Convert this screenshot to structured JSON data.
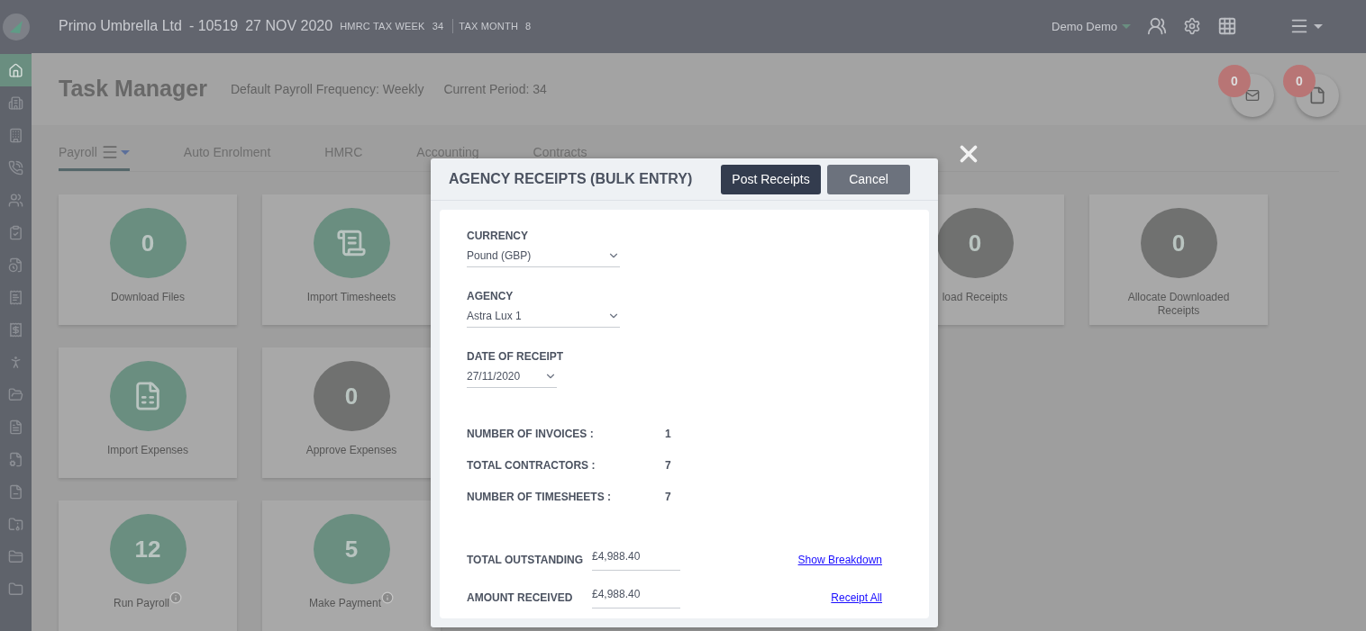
{
  "header": {
    "company": "Primo Umbrella Ltd",
    "company_code": "- 10519",
    "date": "27 NOV 2020",
    "tax_week_label": "HMRC TAX WEEK",
    "tax_week": "34",
    "tax_month_label": "TAX MONTH",
    "tax_month": "8",
    "user": "Demo Demo"
  },
  "sidebar": {
    "items": [
      {
        "selected": true
      },
      {
        "selected": false
      },
      {
        "selected": false
      },
      {
        "selected": false
      },
      {
        "selected": false
      },
      {
        "selected": false
      },
      {
        "selected": false
      },
      {
        "selected": false
      },
      {
        "selected": false
      },
      {
        "selected": false
      },
      {
        "selected": false
      },
      {
        "selected": false
      },
      {
        "selected": false
      },
      {
        "selected": false
      },
      {
        "selected": false
      },
      {
        "selected": false
      },
      {
        "selected": false
      }
    ]
  },
  "page": {
    "title": "Task Manager",
    "frequency": "Default Payroll Frequency: Weekly",
    "period": "Current Period: 34",
    "message_count": "0",
    "document_count": "0"
  },
  "tabs": [
    {
      "label": "Payroll",
      "selected": true
    },
    {
      "label": "Auto Enrolment",
      "selected": false
    },
    {
      "label": "HMRC",
      "selected": false
    },
    {
      "label": "Accounting",
      "selected": false
    },
    {
      "label": "Contracts",
      "selected": false
    }
  ],
  "tile_rows": [
    {
      "left": [
        {
          "kind": "count",
          "value": "0",
          "label": "Download Files",
          "color": "#6a8e80",
          "info": false
        },
        {
          "kind": "timesheet",
          "label": "Import Timesheets",
          "color": "#6a8e80",
          "info": false
        }
      ],
      "right": [
        {
          "kind": "count",
          "value": "0",
          "label": "load Receipts",
          "color": "#707170",
          "info": false
        },
        {
          "kind": "count",
          "value": "0",
          "label": "Allocate Downloaded Receipts",
          "color": "#707170",
          "info": false
        }
      ]
    },
    {
      "left": [
        {
          "kind": "expense",
          "label": "Import Expenses",
          "color": "#6a8e80",
          "info": false
        },
        {
          "kind": "count",
          "value": "0",
          "label": "Approve Expenses",
          "color": "#707170",
          "info": false
        }
      ],
      "right": []
    },
    {
      "left": [
        {
          "kind": "count",
          "value": "12",
          "label": "Run Payroll",
          "color": "#6a8e80",
          "info": true
        },
        {
          "kind": "count",
          "value": "5",
          "label": "Make Payment",
          "color": "#6a8e80",
          "info": true
        }
      ],
      "right": []
    }
  ],
  "modal": {
    "title": "AGENCY RECEIPTS (BULK ENTRY)",
    "post_button": "Post Receipts",
    "cancel_button": "Cancel",
    "currency": {
      "label": "CURRENCY",
      "value": "Pound (GBP)"
    },
    "agency": {
      "label": "AGENCY",
      "value": "Astra Lux 1"
    },
    "date": {
      "label": "DATE OF RECEIPT",
      "value": "27/11/2020"
    },
    "stats": [
      {
        "label": "NUMBER OF INVOICES :",
        "value": "1"
      },
      {
        "label": "TOTAL CONTRACTORS :",
        "value": "7"
      },
      {
        "label": "NUMBER OF TIMESHEETS :",
        "value": "7"
      }
    ],
    "amounts": [
      {
        "label": "TOTAL OUTSTANDING",
        "value": "£4,988.40",
        "link": "Show Breakdown"
      },
      {
        "label": "AMOUNT RECEIVED",
        "value": "£4,988.40",
        "link": "Receipt All"
      }
    ]
  }
}
